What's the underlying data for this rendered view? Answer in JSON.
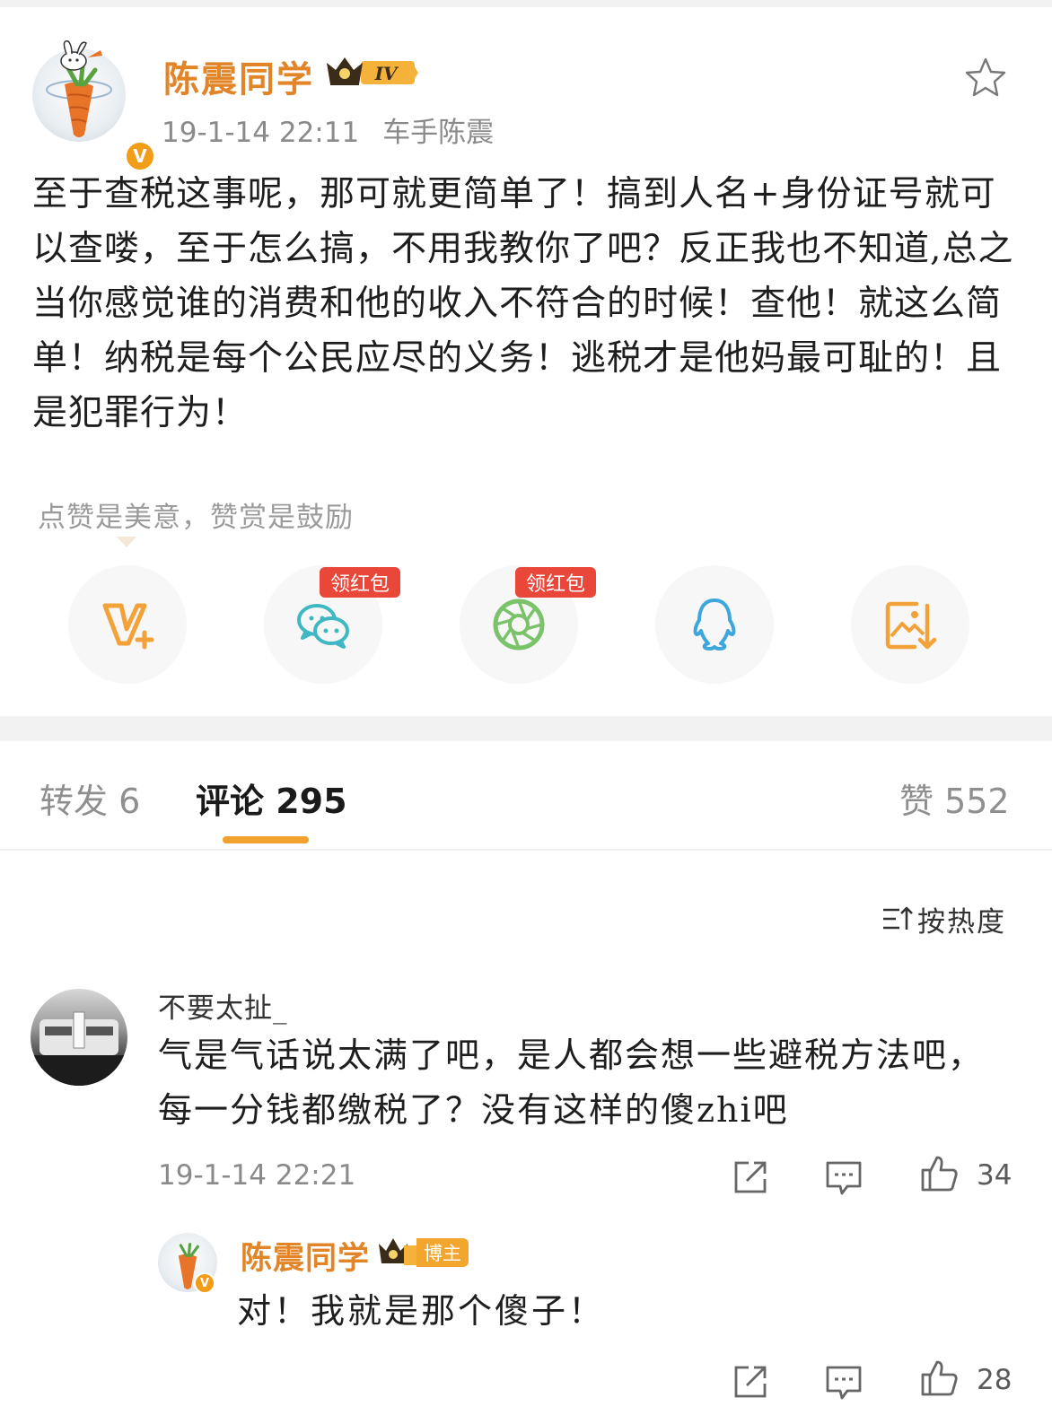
{
  "post": {
    "author_name": "陈震同学",
    "level_badge": "IV",
    "timestamp": "19-1-14 22:11",
    "device": "车手陈震",
    "verified_mark": "V",
    "body": "至于查税这事呢，那可就更简单了！搞到人名+身份证号就可以查喽，至于怎么搞，不用我教你了吧？反正我也不知道,总之当你感觉谁的消费和他的收入不符合的时候！查他！就这么简单！纳税是每个公民应尽的义务！逃税才是他妈最可耻的！且是犯罪行为！",
    "reward_hint": "点赞是美意，赞赏是鼓励"
  },
  "share": {
    "buttons": [
      {
        "name": "vplus",
        "icon": "v-plus-icon"
      },
      {
        "name": "wechat",
        "icon": "wechat-icon",
        "tag": "领红包"
      },
      {
        "name": "moments",
        "icon": "moments-icon",
        "tag": "领红包"
      },
      {
        "name": "qq",
        "icon": "qq-icon"
      },
      {
        "name": "save_image",
        "icon": "save-image-icon"
      }
    ]
  },
  "tabs": {
    "repost": "转发 6",
    "comments": "评论 295",
    "likes": "赞 552"
  },
  "sort": {
    "label": "按热度"
  },
  "comments": [
    {
      "author": "不要太扯_",
      "text": "气是气话说太满了吧，是人都会想一些避税方法吧，每一分钱都缴税了？没有这样的傻zhi吧",
      "time": "19-1-14 22:21",
      "likes": "34",
      "reply": {
        "author": "陈震同学",
        "badge": "博主",
        "text": "对！我就是那个傻子！",
        "likes": "28"
      }
    }
  ],
  "colors": {
    "accent": "#e28529",
    "redpack": "#e9473a",
    "tab_underline": "#f2a12c",
    "verified": "#f29d18"
  }
}
